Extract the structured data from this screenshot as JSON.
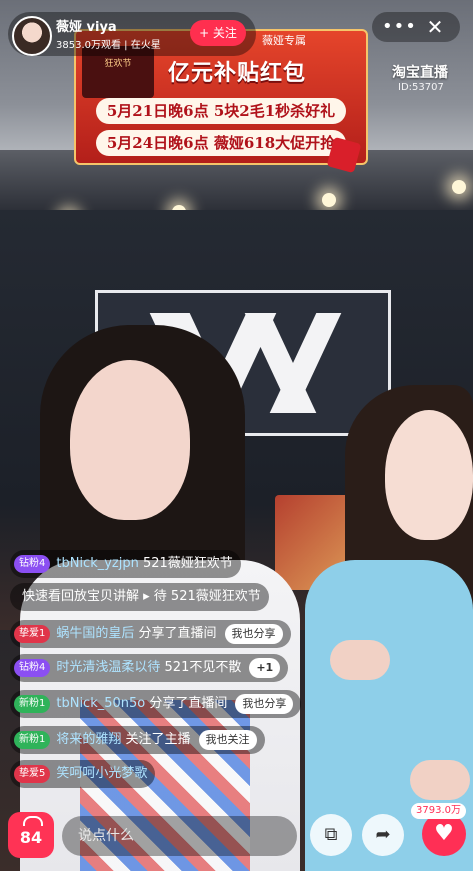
{
  "anchor": {
    "name": "薇娅 viya",
    "stats": "3853.0万观看 | 在火星",
    "follow_label": "+ 关注"
  },
  "top_right": {
    "more_icon": "•••",
    "close_icon": "✕",
    "platform": "淘宝直播",
    "room_id": "ID:53707"
  },
  "promo": {
    "badge_text": "狂欢节",
    "subtitle": "薇娅专属",
    "title": "亿元补贴红包",
    "line1": "5月21日晚6点  5块2毛1秒杀好礼",
    "line2": "5月24日晚6点  薇娅618大促开抢"
  },
  "comments": [
    {
      "badge": "钻粉4",
      "user": "tbNick_yzjpn",
      "text": " 521薇娅狂欢节"
    },
    {
      "badge": "",
      "user": "",
      "text": "快速看回放宝贝讲解 ▸ 待 521薇娅狂欢节"
    },
    {
      "badge": "挚爱1",
      "user": "蜗牛国的皇后",
      "text": " 分享了直播间",
      "action": "我也分享"
    },
    {
      "badge": "钻粉4",
      "user": "时光清浅温柔以待",
      "text": " 521不见不散",
      "action": "+1"
    },
    {
      "badge": "新粉1",
      "user": "tbNick_50n5o",
      "text": " 分享了直播间",
      "action": "我也分享"
    },
    {
      "badge": "新粉1",
      "user": "将来的雅翔",
      "text": " 关注了主播",
      "action": "我也关注"
    },
    {
      "badge": "挚爱5",
      "user": "笑呵呵小光梦歌",
      "text": ""
    }
  ],
  "bottom": {
    "bag_count": "84",
    "input_placeholder": "说点什么",
    "copy_icon": "⧉",
    "share_icon": "➦",
    "like_icon": "♥",
    "like_count": "3793.0万"
  },
  "colors": {
    "accent_red": "#ff2f55",
    "promo_red": "#d93a26",
    "diamond_badge": "#8b4ff2",
    "fan_badge": "#e0354a",
    "new_badge": "#2fb35a"
  },
  "backdrop_logo": "VK"
}
